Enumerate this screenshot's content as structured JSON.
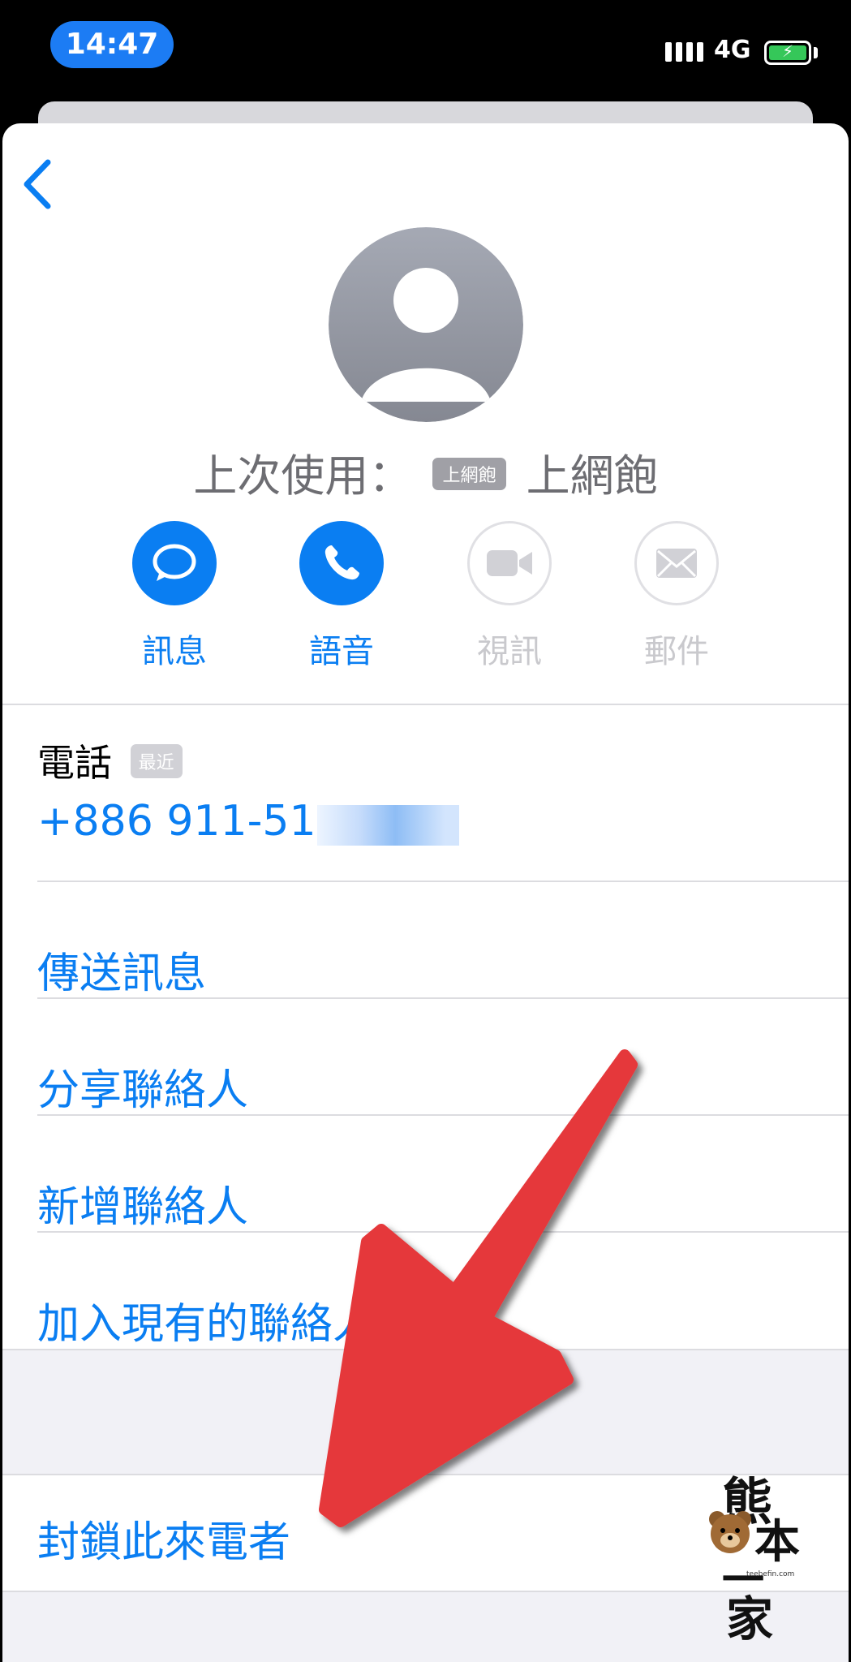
{
  "status_bar": {
    "time": "14:47",
    "network": "4G",
    "battery_charging": true,
    "colors": {
      "time_pill": "#1c7cf4",
      "battery": "#35c759"
    }
  },
  "contact": {
    "last_used_prefix": "上次使用：",
    "last_used_tag": "上網飽",
    "last_used_value": "上網飽"
  },
  "actions": [
    {
      "label": "訊息",
      "icon": "message-icon",
      "enabled": true
    },
    {
      "label": "語音",
      "icon": "phone-icon",
      "enabled": true
    },
    {
      "label": "視訊",
      "icon": "video-icon",
      "enabled": false
    },
    {
      "label": "郵件",
      "icon": "mail-icon",
      "enabled": false
    }
  ],
  "phone": {
    "label": "電話",
    "recent_tag": "最近",
    "number": "+886 911-51"
  },
  "menu": {
    "send_message": "傳送訊息",
    "share_contact": "分享聯絡人",
    "new_contact": "新增聯絡人",
    "add_existing": "加入現有的聯絡人",
    "block_caller": "封鎖此來電者"
  },
  "watermark": {
    "logo_text": [
      "熊",
      "本",
      "一",
      "家"
    ],
    "site": "teebefin.com"
  },
  "colors": {
    "accent": "#0a7ef2",
    "arrow": "#e5383b",
    "disabled": "#c9c9cd"
  }
}
